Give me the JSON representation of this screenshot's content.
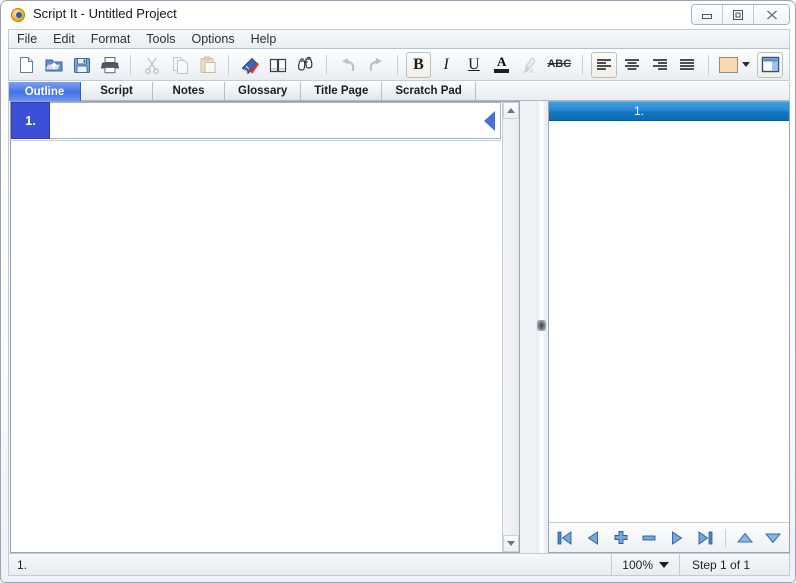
{
  "window": {
    "title": "Script It - Untitled Project",
    "app_icon": "script-it-app-icon",
    "controls": {
      "minimize": "minimize-icon",
      "maximize": "maximize-icon",
      "close": "close-icon"
    }
  },
  "menubar": {
    "items": [
      {
        "label": "File"
      },
      {
        "label": "Edit"
      },
      {
        "label": "Format"
      },
      {
        "label": "Tools"
      },
      {
        "label": "Options"
      },
      {
        "label": "Help"
      }
    ]
  },
  "toolbar": {
    "items": [
      {
        "name": "new-document",
        "icon": "new-page-icon",
        "enabled": true
      },
      {
        "name": "open-project",
        "icon": "open-folder-icon",
        "enabled": true
      },
      {
        "name": "save-project",
        "icon": "save-floppy-icon",
        "enabled": true
      },
      {
        "name": "print",
        "icon": "printer-icon",
        "enabled": true
      },
      {
        "name": "cut",
        "icon": "scissors-icon",
        "enabled": false
      },
      {
        "name": "copy",
        "icon": "copy-icon",
        "enabled": false
      },
      {
        "name": "paste",
        "icon": "paste-icon",
        "enabled": false
      },
      {
        "name": "spell-check",
        "icon": "spell-check-icon",
        "enabled": true
      },
      {
        "name": "dictionary",
        "icon": "book-icon",
        "enabled": true
      },
      {
        "name": "find",
        "icon": "binoculars-icon",
        "enabled": true
      },
      {
        "name": "undo",
        "icon": "undo-arrow-icon",
        "enabled": false
      },
      {
        "name": "redo",
        "icon": "redo-arrow-icon",
        "enabled": false
      },
      {
        "name": "bold",
        "icon": "bold-icon",
        "label": "B",
        "pressed": true
      },
      {
        "name": "italic",
        "icon": "italic-icon",
        "label": "I"
      },
      {
        "name": "underline",
        "icon": "underline-icon",
        "label": "U"
      },
      {
        "name": "font-color",
        "icon": "font-color-icon",
        "label": "A"
      },
      {
        "name": "highlight",
        "icon": "highlight-icon",
        "enabled": false
      },
      {
        "name": "strikethrough",
        "icon": "strikethrough-icon",
        "label": "ABC"
      },
      {
        "name": "align-left",
        "icon": "align-left-icon",
        "pressed": true
      },
      {
        "name": "align-center",
        "icon": "align-center-icon"
      },
      {
        "name": "align-right",
        "icon": "align-right-icon"
      },
      {
        "name": "align-justify",
        "icon": "align-justify-icon"
      },
      {
        "name": "page-color",
        "icon": "color-swatch-icon",
        "color": "#fbd9b0"
      },
      {
        "name": "toggle-preview-panel",
        "icon": "split-panel-icon",
        "pressed": true
      }
    ],
    "swatch_color": "#fbd9b0",
    "bold_label": "B",
    "italic_label": "I",
    "underline_label": "U",
    "fontcolor_label": "A",
    "strike_label": "ABC"
  },
  "tabs": {
    "active_index": 0,
    "items": [
      {
        "label": "Outline"
      },
      {
        "label": "Script"
      },
      {
        "label": "Notes"
      },
      {
        "label": "Glossary"
      },
      {
        "label": "Title Page"
      },
      {
        "label": "Scratch Pad"
      }
    ]
  },
  "outline": {
    "rows": [
      {
        "number": "1.",
        "text": ""
      }
    ],
    "marker_icon": "current-step-marker-icon",
    "scrollbar": {
      "up_icon": "scroll-up-icon",
      "down_icon": "scroll-down-icon"
    }
  },
  "preview": {
    "header_label": "1.",
    "body_text": "",
    "nav": [
      {
        "name": "first-step-button",
        "icon": "first-icon"
      },
      {
        "name": "previous-step-button",
        "icon": "previous-icon"
      },
      {
        "name": "add-step-button",
        "icon": "plus-icon"
      },
      {
        "name": "remove-step-button",
        "icon": "minus-icon"
      },
      {
        "name": "next-step-button",
        "icon": "next-icon"
      },
      {
        "name": "last-step-button",
        "icon": "last-icon"
      },
      {
        "name": "move-step-up-button",
        "icon": "triangle-up-icon"
      },
      {
        "name": "move-step-down-button",
        "icon": "triangle-down-icon"
      }
    ]
  },
  "statusbar": {
    "left_text": "1.",
    "zoom_value": "100%",
    "step_text": "Step 1 of 1"
  },
  "colors": {
    "tab_active": "#4a78e8",
    "row_number_bg": "#3b4fd8",
    "preview_header_bg": "#1276c2",
    "nav_icon_blue": "#3f78cf",
    "marker_blue": "#4a6fd6"
  }
}
